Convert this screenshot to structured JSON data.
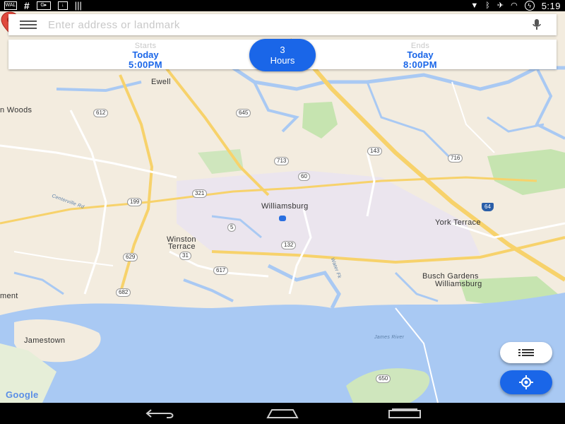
{
  "status_bar": {
    "left_icons": [
      "wal-icon",
      "hash-icon",
      "cast-icon",
      "download-icon",
      "barcode-icon"
    ],
    "left_texts": {
      "wal": "WAL",
      "hash": "#",
      "cast": "G▸"
    },
    "time": "5:19"
  },
  "search": {
    "placeholder": "Enter address or landmark",
    "value": ""
  },
  "time_bar": {
    "start": {
      "caption": "Starts",
      "day": "Today",
      "time": "5:00PM"
    },
    "duration": {
      "value": "3",
      "unit": "Hours"
    },
    "end": {
      "caption": "Ends",
      "day": "Today",
      "time": "8:00PM"
    }
  },
  "map": {
    "places": {
      "ewell": "Ewell",
      "woods": "n Woods",
      "williamsburg": "Williamsburg",
      "winston_terrace_1": "Winston",
      "winston_terrace_2": "Terrace",
      "york_terrace": "York Terrace",
      "busch_1": "Busch Gardens",
      "busch_2": "Williamsburg",
      "jamestown": "Jamestown",
      "ement": "ment",
      "james_river": "James River",
      "water_fork": "Water Fk",
      "neck_rd": "Centerville Rd"
    },
    "shields": [
      "612",
      "645",
      "713",
      "143",
      "60",
      "716",
      "321",
      "199",
      "5",
      "132",
      "31",
      "64",
      "629",
      "617",
      "682",
      "650"
    ]
  },
  "google_logo": "Google",
  "colors": {
    "accent": "#1a66e8",
    "map_land": "#f3ecdf",
    "water": "#a9c9f3",
    "park": "#c6e4b0",
    "highway": "#f7d26b",
    "marker": "#e04a3d"
  }
}
